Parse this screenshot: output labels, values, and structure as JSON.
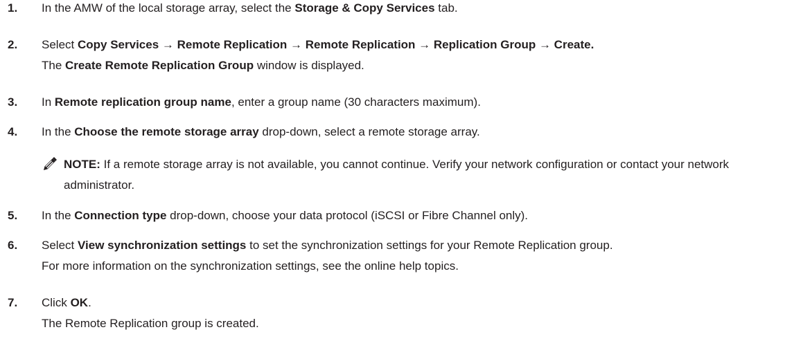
{
  "steps": [
    {
      "number": "1.",
      "line1": {
        "a": "In the AMW of the local storage array, select the ",
        "b": "Storage & Copy Services",
        "c": " tab."
      }
    },
    {
      "number": "2.",
      "line1": {
        "a": "Select ",
        "b": "Copy Services → Remote Replication → Remote Replication → Replication Group → Create."
      },
      "line2": {
        "a": "The ",
        "b": "Create Remote Replication Group",
        "c": " window is displayed."
      }
    },
    {
      "number": "3.",
      "line1": {
        "a": "In ",
        "b": "Remote replication group name",
        "c": ", enter a group name (30 characters maximum)."
      }
    },
    {
      "number": "4.",
      "line1": {
        "a": "In the ",
        "b": "Choose the remote storage array",
        "c": " drop-down, select a remote storage array."
      },
      "note": {
        "label": "NOTE:",
        "text": " If a remote storage array is not available, you cannot continue. Verify your network configuration or contact your network administrator."
      }
    },
    {
      "number": "5.",
      "line1": {
        "a": "In the ",
        "b": "Connection type",
        "c": " drop-down, choose your data protocol (iSCSI or Fibre Channel only)."
      }
    },
    {
      "number": "6.",
      "line1": {
        "a": "Select ",
        "b": "View synchronization settings",
        "c": " to set the synchronization settings for your Remote Replication group."
      },
      "line2": {
        "text": "For more information on the synchronization settings, see the online help topics."
      }
    },
    {
      "number": "7.",
      "line1": {
        "a": "Click ",
        "b": "OK",
        "c": "."
      },
      "line2": {
        "text": "The Remote Replication group is created."
      }
    }
  ]
}
